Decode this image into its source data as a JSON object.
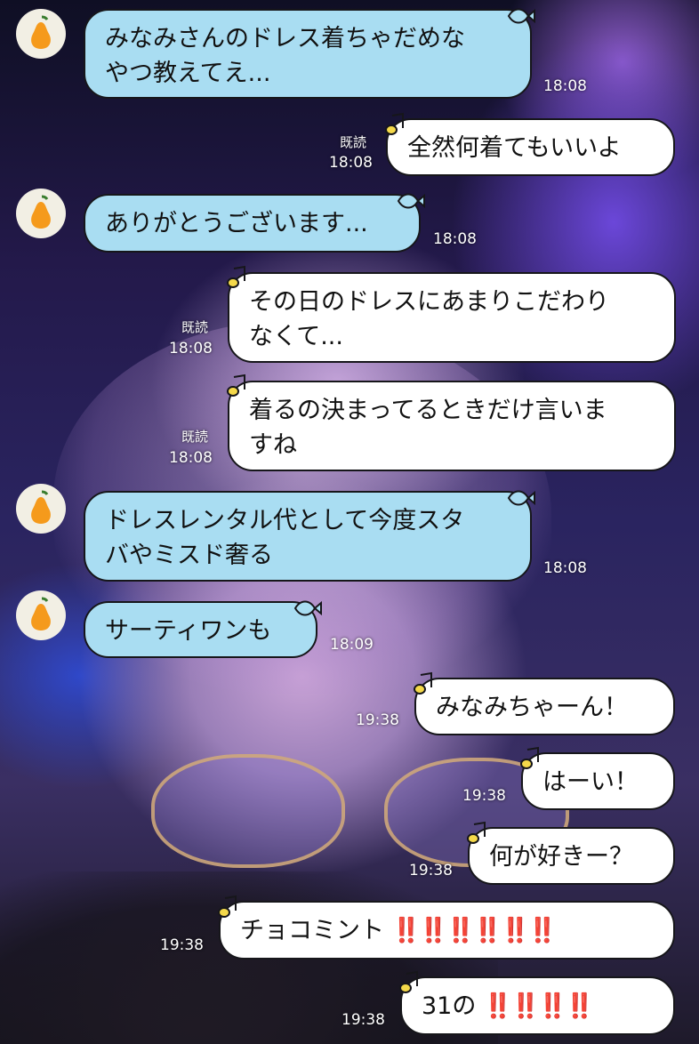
{
  "messages": [
    {
      "side": "in",
      "text": "みなみさんのドレス着ちゃだめな\nやつ教えてえ...",
      "time": "18:08"
    },
    {
      "side": "out",
      "text": "全然何着てもいいよ",
      "time": "18:08",
      "read": "既読"
    },
    {
      "side": "in",
      "text": "ありがとうございます...",
      "time": "18:08"
    },
    {
      "side": "out",
      "text": "その日のドレスにあまりこだわり\nなくて...",
      "time": "18:08",
      "read": "既読"
    },
    {
      "side": "out",
      "text": "着るの決まってるときだけ言いま\nすね",
      "time": "18:08",
      "read": "既読"
    },
    {
      "side": "in",
      "text": "ドレスレンタル代として今度スタ\nバやミスド奢る",
      "time": "18:08"
    },
    {
      "side": "in",
      "text": "サーティワンも",
      "time": "18:09"
    },
    {
      "side": "out",
      "text": "みなみちゃーん！",
      "time": "19:38"
    },
    {
      "side": "out",
      "text": "はーい！",
      "time": "19:38"
    },
    {
      "side": "out",
      "text": "何が好きー？",
      "time": "19:38"
    },
    {
      "side": "out",
      "text": "チョコミント",
      "emoji": "‼️‼️‼️‼️‼️‼️",
      "time": "19:38"
    },
    {
      "side": "out",
      "text": "31の",
      "emoji": "‼️‼️‼️‼️",
      "time": "19:38"
    }
  ],
  "icons": {
    "avatar": "pear-icon",
    "incoming_deco": "fish-icon",
    "outgoing_deco": "music-note-icon"
  },
  "colors": {
    "incoming_bubble": "#a9ddf2",
    "outgoing_bubble": "#ffffff",
    "emoji_red": "#e8221f"
  }
}
